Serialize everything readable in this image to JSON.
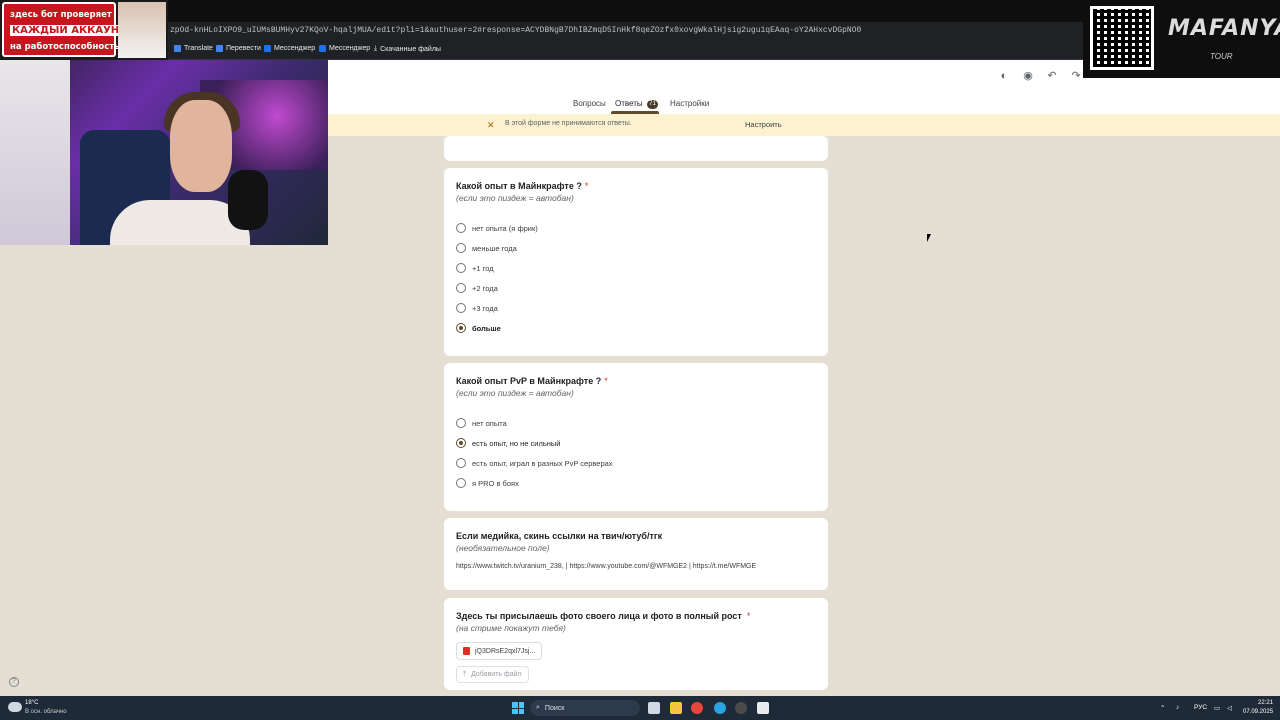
{
  "browser": {
    "url": "zpOd-knHLoIXPO9_uIUMsBUMHyv27KQoV-hqaljMUA/edit?pli=1&authuser=2#response=ACYDBNgB7DhIBZmqD5InHkf8qeZOzfx0xovgWkalHjsig2ugu1qEAaq-oY2AHxcvDGpNO0",
    "bookmarks": [
      "Translate",
      "Перевести",
      "Мессенджер",
      "Мессенджер",
      "Скачанные файлы"
    ]
  },
  "forms": {
    "tabs": {
      "questions": "Вопросы",
      "responses": "Ответы",
      "responses_count": "71",
      "settings": "Настройки"
    },
    "notice": {
      "text": "В этой форме не принимаются ответы.",
      "action": "Настроить"
    }
  },
  "questions": [
    {
      "title": "Какой опыт в Майнкрафте ?",
      "required_mark": "*",
      "description": "(если это пиздеж = автобан)",
      "options": [
        {
          "label": "нет опыта (я фрик)",
          "checked": false
        },
        {
          "label": "меньше года",
          "checked": false
        },
        {
          "label": "+1 год",
          "checked": false
        },
        {
          "label": "+2 года",
          "checked": false
        },
        {
          "label": "+3 года",
          "checked": false
        },
        {
          "label": "больше",
          "checked": true
        }
      ]
    },
    {
      "title": "Какой опыт PvP в Майнкрафте ?",
      "required_mark": "*",
      "description": "(если это пиздеж = автобан)",
      "options": [
        {
          "label": "нет опыта",
          "checked": false
        },
        {
          "label": "есть опыт, но не сильный",
          "checked": true
        },
        {
          "label": "есть опыт, играл в разных PvP серверах",
          "checked": false
        },
        {
          "label": "я PRO в боях",
          "checked": false
        }
      ]
    },
    {
      "title": "Если медийка, скинь ссылки на твич/ютуб/тгк",
      "description": "(необязательное поле)",
      "answer": "https://www.twitch.tv/uranium_238,  | https://www.youtube.com/@WFMGE2 | https://t.me/WFMGE"
    },
    {
      "title": "Здесь ты присылаешь фото своего лица и фото в полный рост",
      "required_mark": "*",
      "description": "(на стриме покажут тебя)",
      "file_name": "jQ3DRsE2qxl7Jsj...",
      "add_file_label": "Добавить файл"
    }
  ],
  "overlay": {
    "promo_lines": [
      "здесь бот проверяет",
      "КАЖДЫЙ АККАУНТ",
      "на работоспособность"
    ],
    "brand": "MAFANYA",
    "brand_sub": "TOUR"
  },
  "taskbar": {
    "weather_temp": "18°C",
    "weather_desc": "В осн. облачно",
    "search_placeholder": "Поиск",
    "lang": "РУС",
    "time": "22:21",
    "date": "07.09.2025"
  },
  "colors": {
    "accent": "#5f4b2d",
    "required": "#d93025",
    "page_bg": "#e4dfd2",
    "notice_bg": "#fdf2d0"
  }
}
